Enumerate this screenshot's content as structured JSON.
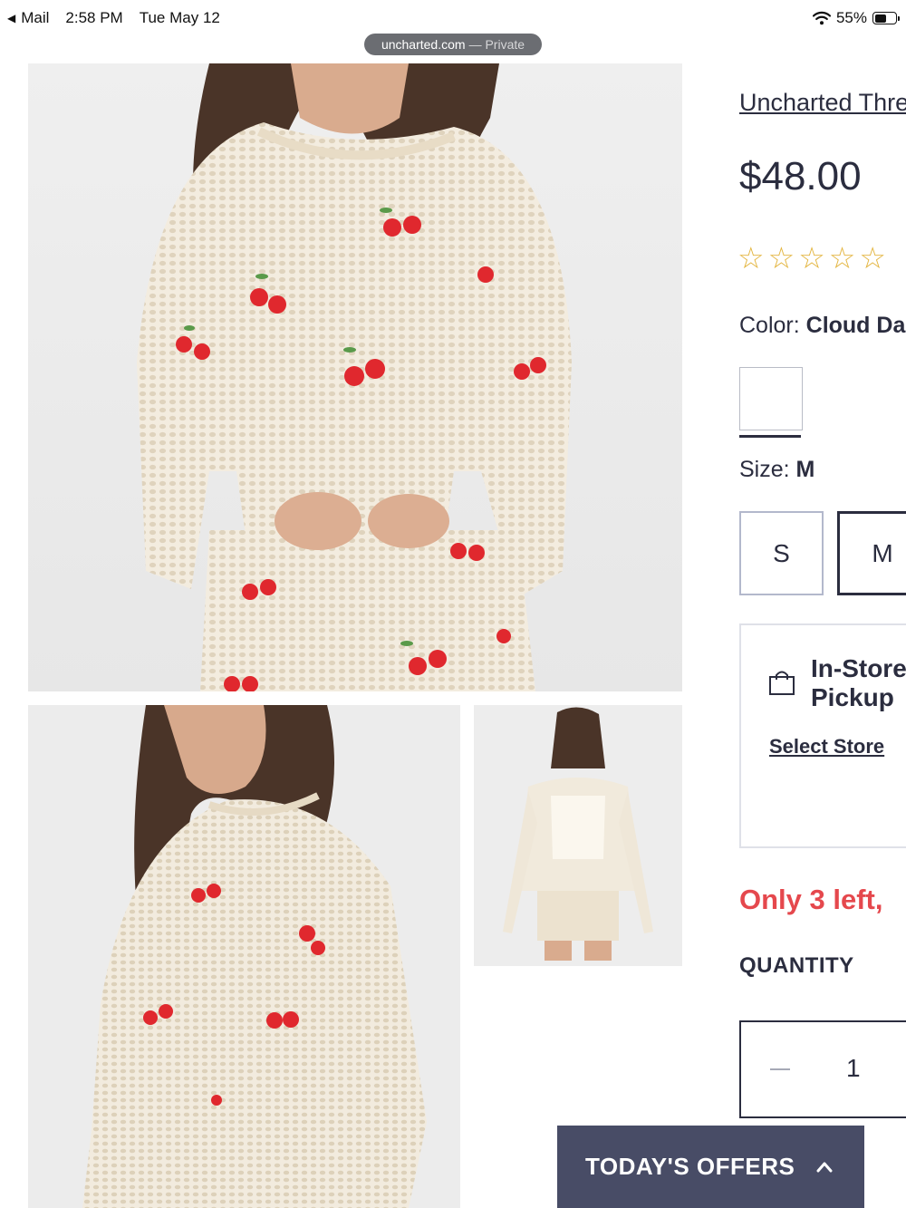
{
  "status_bar": {
    "back_app": "Mail",
    "time": "2:58 PM",
    "date": "Tue May 12",
    "battery": "55%",
    "battery_level": 0.55
  },
  "address_bar": {
    "domain": "uncharted.com",
    "mode": "— Private"
  },
  "product": {
    "brand_link": "Uncharted Thre",
    "price": "$48.00",
    "rating_stars": 0,
    "stars": [
      "☆",
      "☆",
      "☆",
      "☆",
      "☆"
    ],
    "color_label": "Color:",
    "color_value": "Cloud Da",
    "size_label": "Size:",
    "size_value": "M",
    "sizes": [
      "S",
      "M"
    ],
    "selected_size": "M"
  },
  "pickup": {
    "title_line1": "In-Store",
    "title_line2": "Pickup",
    "select_store": "Select Store",
    "icon": "shopping-bag-icon"
  },
  "stock_message": "Only 3 left,",
  "quantity": {
    "label": "QUANTITY",
    "value": "1"
  },
  "offers_button": {
    "label": "TODAY'S OFFERS",
    "icon": "chevron-up-icon"
  },
  "colors": {
    "text": "#2b2d3f",
    "stock_red": "#e5484d",
    "star": "#e3b53f",
    "offers_bg": "#484c66",
    "size_border": "#b3b8cc"
  }
}
